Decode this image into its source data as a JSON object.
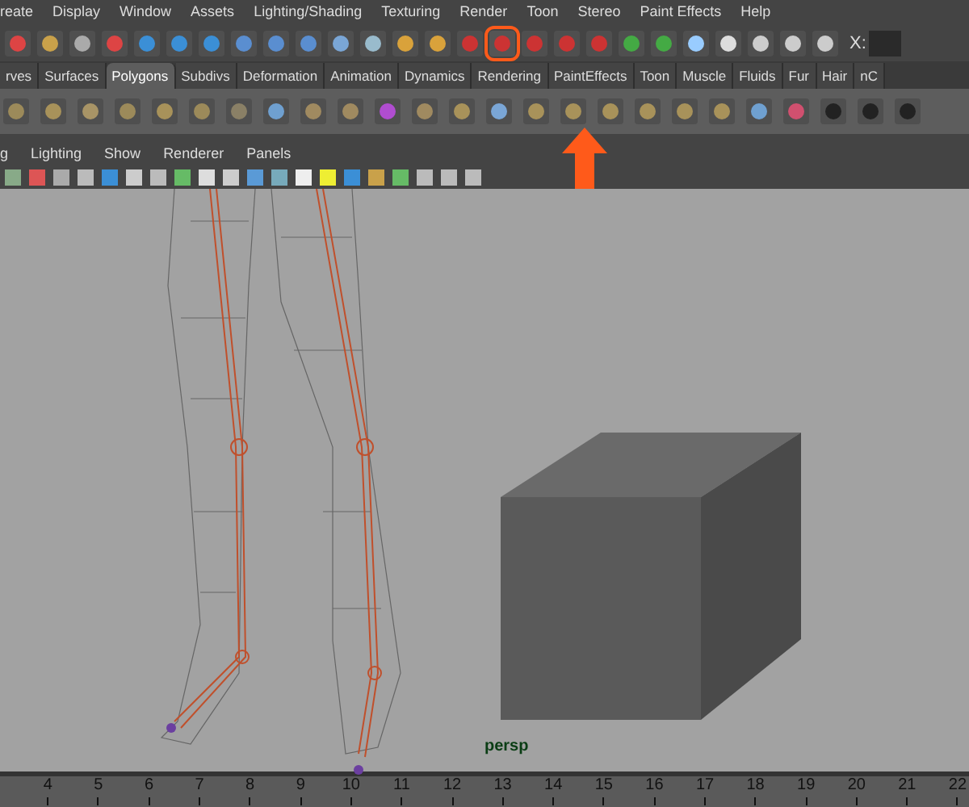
{
  "menu_bar": {
    "items": [
      "reate",
      "Display",
      "Window",
      "Assets",
      "Lighting/Shading",
      "Texturing",
      "Render",
      "Toon",
      "Stereo",
      "Paint Effects",
      "Help"
    ]
  },
  "status_line": {
    "field_label": "X:"
  },
  "shelf": {
    "tabs": [
      {
        "label": "rves",
        "selected": false
      },
      {
        "label": "Surfaces",
        "selected": false
      },
      {
        "label": "Polygons",
        "selected": true
      },
      {
        "label": "Subdivs",
        "selected": false
      },
      {
        "label": "Deformation",
        "selected": false
      },
      {
        "label": "Animation",
        "selected": false
      },
      {
        "label": "Dynamics",
        "selected": false
      },
      {
        "label": "Rendering",
        "selected": false
      },
      {
        "label": "PaintEffects",
        "selected": false
      },
      {
        "label": "Toon",
        "selected": false
      },
      {
        "label": "Muscle",
        "selected": false
      },
      {
        "label": "Fluids",
        "selected": false
      },
      {
        "label": "Fur",
        "selected": false
      },
      {
        "label": "Hair",
        "selected": false
      },
      {
        "label": "nC",
        "selected": false
      }
    ]
  },
  "panel_menu": {
    "items": [
      "g",
      "Lighting",
      "Show",
      "Renderer",
      "Panels"
    ]
  },
  "viewport": {
    "camera_label": "persp"
  },
  "time_slider": {
    "ticks": [
      "4",
      "5",
      "6",
      "7",
      "8",
      "9",
      "10",
      "11",
      "12",
      "13",
      "14",
      "15",
      "16",
      "17",
      "18",
      "19",
      "20",
      "21",
      "22"
    ]
  }
}
